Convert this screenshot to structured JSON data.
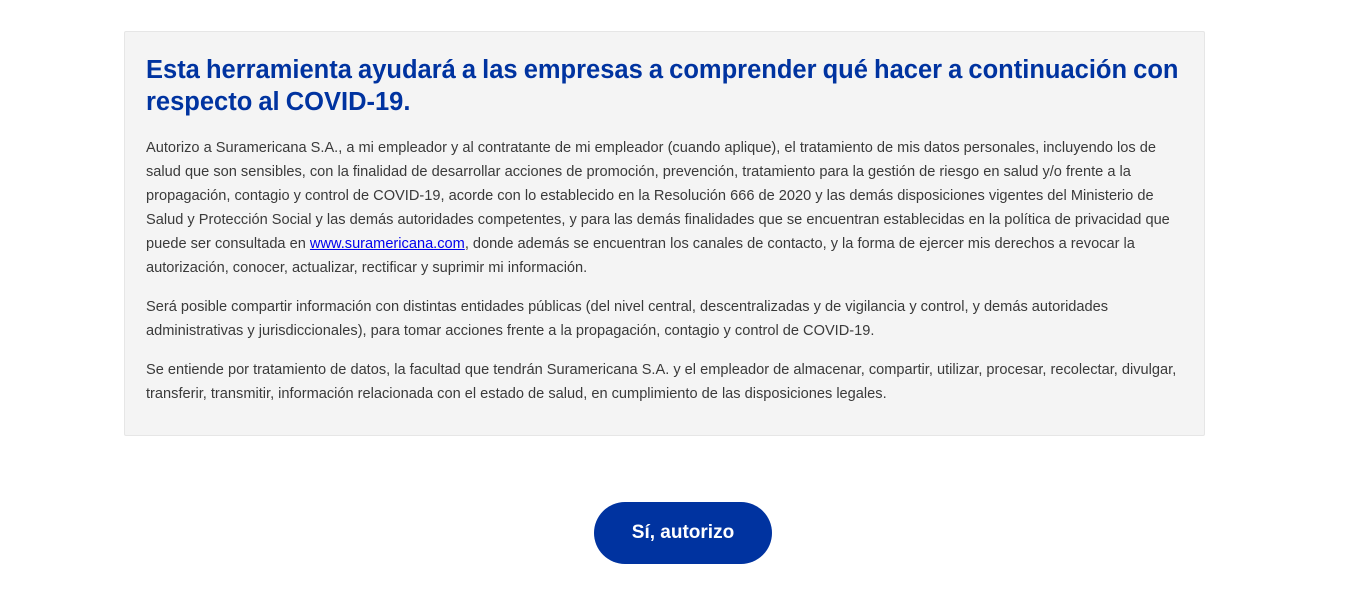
{
  "consent": {
    "title": "Esta herramienta ayudará a las empresas  a comprender qué hacer a continuación con respecto al COVID-19.",
    "paragraph1_before_link": "Autorizo a Suramericana S.A., a mi empleador y al contratante de mi empleador (cuando aplique), el tratamiento de mis datos personales, incluyendo los de salud que son sensibles, con la finalidad de desarrollar acciones de promoción, prevención, tratamiento para la gestión de riesgo en salud y/o frente a la propagación, contagio y control de COVID-19, acorde con lo establecido en la Resolución 666 de 2020 y las demás disposiciones vigentes del Ministerio de Salud y Protección Social y las demás autoridades competentes, y para las demás finalidades que se encuentran establecidas en la política de privacidad que puede ser consultada en ",
    "paragraph1_link_text": "www.suramericana.com",
    "paragraph1_after_link": ", donde además se encuentran los canales de contacto, y la forma de ejercer mis derechos a revocar la autorización, conocer, actualizar, rectificar y suprimir mi información.",
    "paragraph2": "Será posible compartir información con distintas entidades públicas (del nivel central, descentralizadas y de vigilancia y control, y demás autoridades administrativas y jurisdiccionales), para tomar acciones frente a la propagación, contagio y control de COVID-19.",
    "paragraph3": "Se entiende por tratamiento de datos, la facultad que tendrán Suramericana S.A. y el empleador de almacenar, compartir, utilizar, procesar, recolectar, divulgar, transferir, transmitir, información relacionada con el estado de salud, en cumplimiento de las disposiciones legales."
  },
  "actions": {
    "authorize_label": "Sí, autorizo"
  },
  "colors": {
    "brand_blue": "#0033a0",
    "card_background": "#f4f4f4",
    "body_text": "#3a3a3a",
    "link": "#0000ee"
  }
}
